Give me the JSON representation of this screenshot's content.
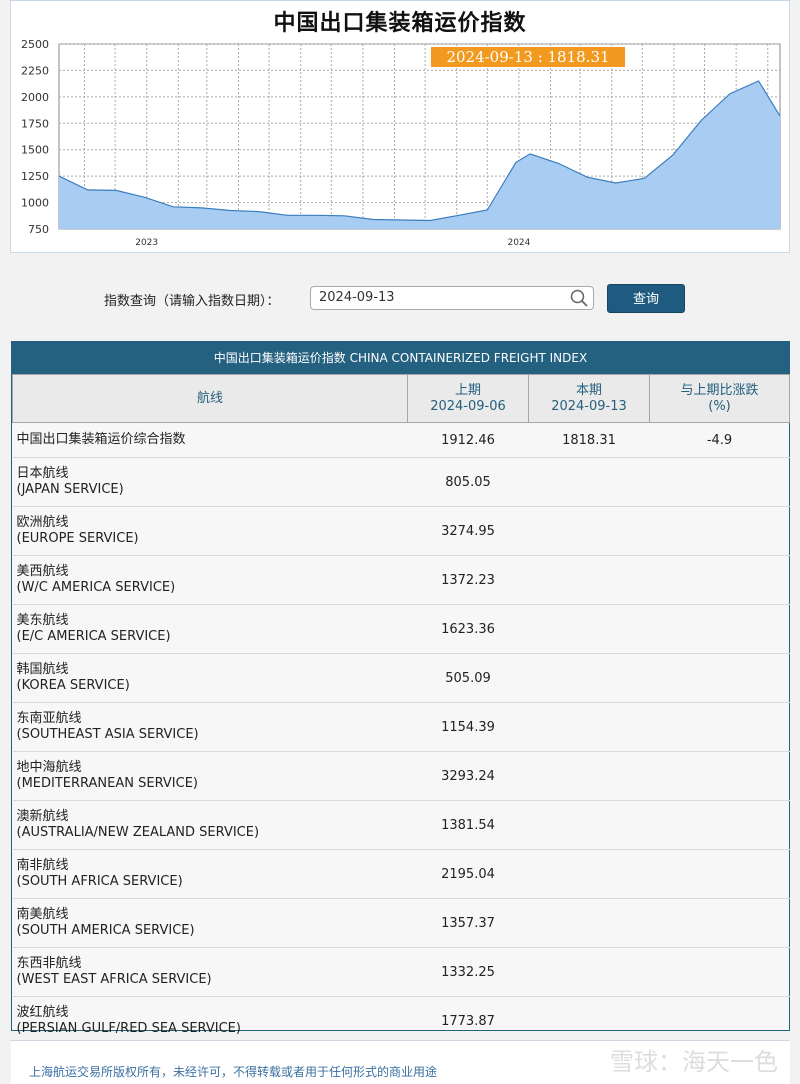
{
  "chart": {
    "title": "中国出口集装箱运价指数",
    "tooltip": "2024-09-13 : 1818.31"
  },
  "chart_data": {
    "type": "area",
    "title": "中国出口集装箱运价指数",
    "y_ticks": [
      750,
      1000,
      1250,
      1500,
      1750,
      2000,
      2250,
      2500
    ],
    "ylim": [
      750,
      2500
    ],
    "x_tick_labels": [
      "2023",
      "2024"
    ],
    "xlim": [
      "2022-10-07",
      "2024-09-13"
    ],
    "x": [
      "2022-10-07",
      "2022-11-04",
      "2022-12-02",
      "2022-12-30",
      "2023-01-27",
      "2023-02-24",
      "2023-03-24",
      "2023-04-21",
      "2023-05-19",
      "2023-06-16",
      "2023-07-14",
      "2023-08-11",
      "2023-09-08",
      "2023-10-06",
      "2023-11-03",
      "2023-12-01",
      "2023-12-29",
      "2024-01-12",
      "2024-02-09",
      "2024-03-08",
      "2024-04-05",
      "2024-05-03",
      "2024-05-31",
      "2024-06-28",
      "2024-07-26",
      "2024-08-23",
      "2024-09-13"
    ],
    "values": [
      1250,
      1120,
      1115,
      1050,
      960,
      950,
      925,
      915,
      880,
      880,
      875,
      840,
      835,
      830,
      880,
      930,
      1380,
      1460,
      1370,
      1240,
      1185,
      1230,
      1450,
      1780,
      2030,
      2150,
      1818.31
    ],
    "grid": true,
    "color": "#a9ccf2"
  },
  "query": {
    "label": "指数查询（请输入指数日期）：",
    "value": "2024-09-13",
    "button": "查询"
  },
  "table": {
    "caption": "中国出口集装箱运价指数 CHINA CONTAINERIZED FREIGHT INDEX",
    "col_route": "航线",
    "col_prev": "上期",
    "col_prev_date": "2024-09-06",
    "col_curr": "本期",
    "col_curr_date": "2024-09-13",
    "col_change": "与上期比涨跌",
    "col_change_unit": "(%)",
    "composite": {
      "name": "中国出口集装箱运价综合指数",
      "prev": "1912.46",
      "curr": "1818.31",
      "change": "-4.9"
    },
    "rows": [
      {
        "cn": "日本航线",
        "en": "(JAPAN SERVICE)",
        "prev": "805.05"
      },
      {
        "cn": "欧洲航线",
        "en": "(EUROPE SERVICE)",
        "prev": "3274.95"
      },
      {
        "cn": "美西航线",
        "en": "(W/C AMERICA SERVICE)",
        "prev": "1372.23"
      },
      {
        "cn": "美东航线",
        "en": "(E/C AMERICA SERVICE)",
        "prev": "1623.36"
      },
      {
        "cn": "韩国航线",
        "en": "(KOREA SERVICE)",
        "prev": "505.09"
      },
      {
        "cn": "东南亚航线",
        "en": "(SOUTHEAST ASIA SERVICE)",
        "prev": "1154.39"
      },
      {
        "cn": "地中海航线",
        "en": "(MEDITERRANEAN SERVICE)",
        "prev": "3293.24"
      },
      {
        "cn": "澳新航线",
        "en": "(AUSTRALIA/NEW ZEALAND SERVICE)",
        "prev": "1381.54"
      },
      {
        "cn": "南非航线",
        "en": "(SOUTH AFRICA SERVICE)",
        "prev": "2195.04"
      },
      {
        "cn": "南美航线",
        "en": "(SOUTH AMERICA SERVICE)",
        "prev": "1357.37"
      },
      {
        "cn": "东西非航线",
        "en": "(WEST EAST AFRICA SERVICE)",
        "prev": "1332.25"
      },
      {
        "cn": "波红航线",
        "en": "(PERSIAN GULF/RED SEA SERVICE)",
        "prev": "1773.87"
      }
    ]
  },
  "footer": {
    "copyright": "上海航运交易所版权所有，未经许可，不得转载或者用于任何形式的商业用途",
    "watermark": "雪球：海天一色"
  }
}
